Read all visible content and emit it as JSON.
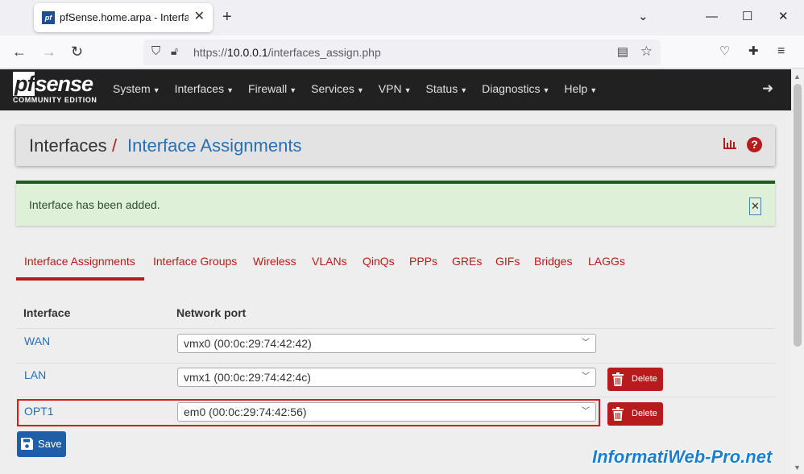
{
  "browser": {
    "tab_title": "pfSense.home.arpa - Interfaces: Interface Assignments",
    "tab_close": "✕",
    "new_tab": "+",
    "favicon_text": "pf",
    "url_prefix": "https://",
    "url_host": "10.0.0.1",
    "url_path": "/interfaces_assign.php",
    "controls": {
      "dropdown": "⌄",
      "minimize": "—",
      "maximize": "☐",
      "close": "✕"
    }
  },
  "logo": {
    "pf": "pf",
    "sense": "sense",
    "edition": "COMMUNITY EDITION"
  },
  "menu": [
    "System",
    "Interfaces",
    "Firewall",
    "Services",
    "VPN",
    "Status",
    "Diagnostics",
    "Help"
  ],
  "breadcrumb": {
    "parent": "Interfaces",
    "separator": "/",
    "current": "Interface Assignments"
  },
  "alert": {
    "message": "Interface has been added.",
    "close": "✕"
  },
  "tabs": [
    "Interface Assignments",
    "Interface Groups",
    "Wireless",
    "VLANs",
    "QinQs",
    "PPPs",
    "GREs",
    "GIFs",
    "Bridges",
    "LAGGs"
  ],
  "active_tab": "Interface Assignments",
  "table": {
    "headers": {
      "interface": "Interface",
      "port": "Network port"
    },
    "rows": [
      {
        "interface": "WAN",
        "port": "vmx0 (00:0c:29:74:42:42)",
        "deletable": false
      },
      {
        "interface": "LAN",
        "port": "vmx1 (00:0c:29:74:42:4c)",
        "deletable": true
      },
      {
        "interface": "OPT1",
        "port": "em0 (00:0c:29:74:42:56)",
        "deletable": true
      }
    ]
  },
  "buttons": {
    "delete": "Delete",
    "save": "Save"
  },
  "watermark": "InformatiWeb-Pro.net",
  "colors": {
    "brand_red": "#b71c1c",
    "link_blue": "#2a6fb0",
    "alert_green": "#dff0d8",
    "header_dark": "#212121",
    "save_blue": "#1e5fa8",
    "highlight": "#e0161d"
  }
}
